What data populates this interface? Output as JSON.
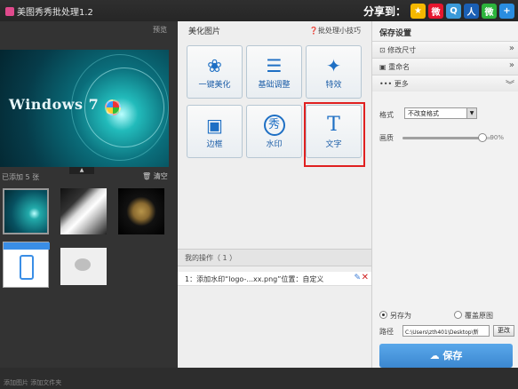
{
  "app": {
    "title": "美图秀秀批处理1.2"
  },
  "share": {
    "label": "分享到：",
    "services": [
      {
        "icon": "qzone-icon",
        "color": "#f5b800",
        "glyph": "★"
      },
      {
        "icon": "weibo-icon",
        "color": "#e6162d",
        "glyph": "微"
      },
      {
        "icon": "tencent-weibo-icon",
        "color": "#3a9ad9",
        "glyph": "Q"
      },
      {
        "icon": "renren-icon",
        "color": "#1a5fb4",
        "glyph": "人"
      },
      {
        "icon": "wechat-icon",
        "color": "#2cb33b",
        "glyph": "微"
      },
      {
        "icon": "more-icon",
        "color": "#2a8de0",
        "glyph": "+"
      }
    ]
  },
  "left": {
    "preview_link": "预览",
    "preview_text": "Windows 7",
    "added_count": "已添加 5 张",
    "clear": "清空",
    "bottom_text": "添加图片    添加文件夹"
  },
  "center": {
    "title": "美化图片",
    "tips": "批处理小技巧",
    "tools": [
      {
        "label": "一键美化",
        "icon": "one-click-beautify-icon",
        "glyph": "❀"
      },
      {
        "label": "基础调整",
        "icon": "basic-adjust-icon",
        "glyph": "☰"
      },
      {
        "label": "特效",
        "icon": "effects-wand-icon",
        "glyph": "✦"
      },
      {
        "label": "边框",
        "icon": "frame-icon",
        "glyph": "▣"
      },
      {
        "label": "水印",
        "icon": "watermark-icon",
        "glyph": "秀"
      },
      {
        "label": "文字",
        "icon": "text-icon",
        "glyph": "T"
      }
    ],
    "ops_title": "我的操作（ 1 ）",
    "op_item": "1：添加水印“logo-...xx.png”位置：自定义"
  },
  "right": {
    "title": "保存设置",
    "sections": [
      "修改尺寸",
      "重命名",
      "更多"
    ],
    "format_label": "格式",
    "format_value": "不改变格式",
    "quality_label": "画质",
    "quality_value": "90%",
    "quality_level": 0.9,
    "save_as": "另存为",
    "overwrite": "覆盖原图",
    "path_label": "路径",
    "path_value": "C:\\Users\\zth401\\Desktop\\新",
    "change": "更改",
    "save_button": "保存"
  }
}
